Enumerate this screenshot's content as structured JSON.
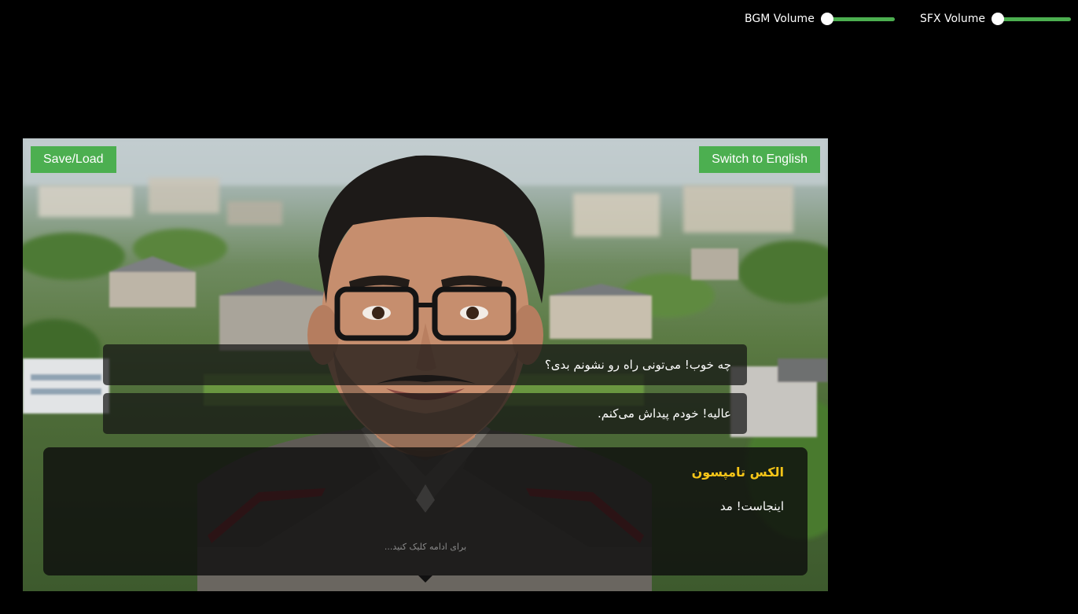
{
  "audio": {
    "bgm_label": "BGM Volume",
    "bgm_level": 0,
    "sfx_label": "SFX Volume",
    "sfx_level": 0
  },
  "toolbar": {
    "save_load_label": "Save/Load",
    "switch_language_label": "Switch to English"
  },
  "choices": [
    "چه خوب! می‌تونی راه رو نشونم بدی؟",
    "عالیه! خودم پیداش می‌کنم."
  ],
  "dialog": {
    "speaker": "الکس تامپسون",
    "text": "اینجاست! مد",
    "continue_hint": "برای ادامه کلیک کنید..."
  },
  "colors": {
    "accent": "#4caf50",
    "speaker": "#f5c518"
  }
}
